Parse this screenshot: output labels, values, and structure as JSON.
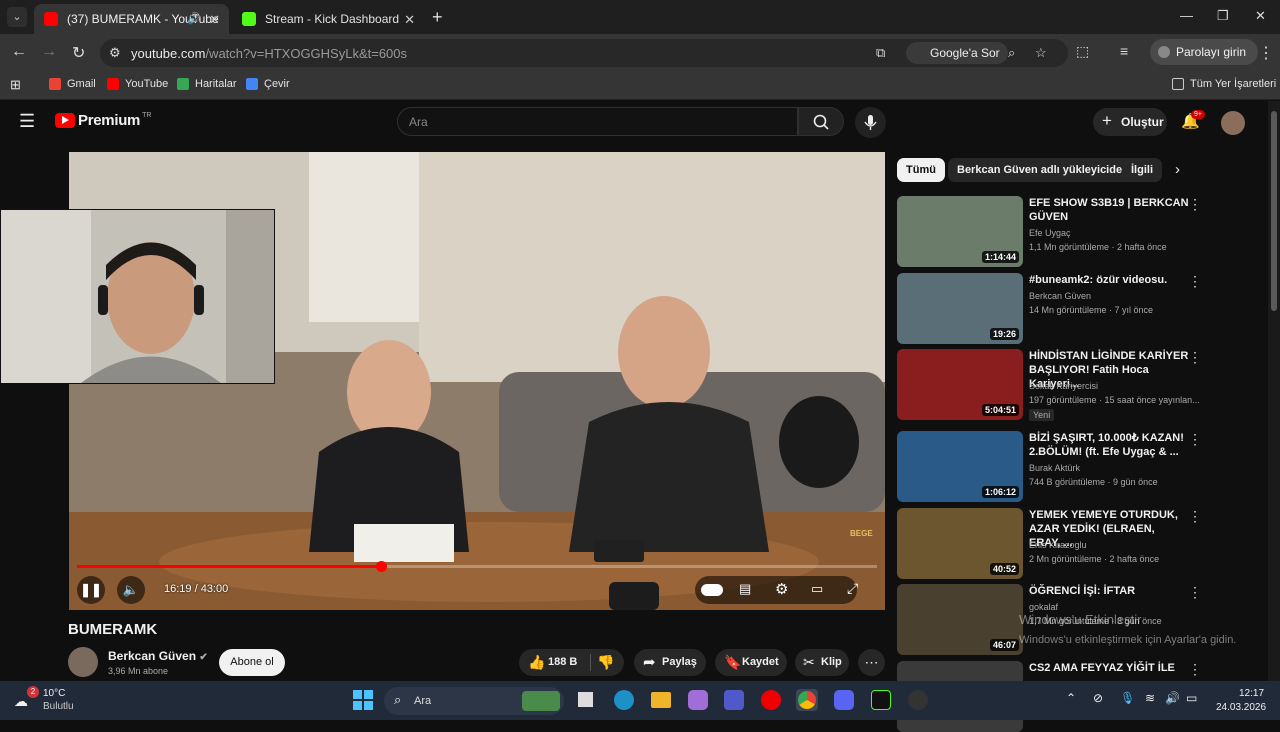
{
  "browser": {
    "tabs": [
      {
        "title": "(37) BUMERAMK - YouTube",
        "active": true
      },
      {
        "title": "Stream - Kick Dashboard",
        "active": false
      }
    ],
    "url_host": "youtube.com",
    "url_path": "/watch?v=HTXOGGHSyLk&t=600s",
    "google_ask": "Google'a Sor",
    "profile_button": "Parolayı girin",
    "bookmarks": [
      "Gmail",
      "YouTube",
      "Haritalar",
      "Çevir"
    ],
    "all_bookmarks": "Tüm Yer İşaretleri"
  },
  "youtube": {
    "logo": "Premium",
    "logo_region": "TR",
    "search_placeholder": "Ara",
    "create_label": "Oluştur",
    "notification_count": "9+"
  },
  "video": {
    "title": "BUMERAMK",
    "time": "16:19 / 43:00",
    "progress": 0.38,
    "channel": "Berkcan Güven",
    "subscribers": "3,96 Mn abone",
    "subscribe_label": "Abone ol",
    "likes": "188 B",
    "share_label": "Paylaş",
    "save_label": "Kaydet",
    "clip_label": "Klip",
    "watermark": "BEGE"
  },
  "chips": [
    "Tümü",
    "Berkcan Güven adlı yükleyiciden",
    "İlgili"
  ],
  "suggestions": [
    {
      "title": "EFE SHOW S3B19 | BERKCAN GÜVEN",
      "channel": "Efe Uygaç",
      "meta": "1,1 Mn görüntüleme · 2 hafta önce",
      "duration": "1:14:44",
      "thumb_color": "#6b7d6a"
    },
    {
      "title": "#buneamk2: özür videosu.",
      "channel": "Berkcan Güven",
      "meta": "14 Mn görüntüleme · 7 yıl önce",
      "duration": "19:26",
      "thumb_color": "#5a6e78"
    },
    {
      "title": "HİNDİSTAN LİGİNDE KARİYER BAŞLIYOR! Fatih Hoca Kariyeri...",
      "channel": "Sokak Kariyercisi",
      "meta": "197 görüntüleme · 15 saat önce yayınlan...",
      "duration": "5:04:51",
      "badge": "Yeni",
      "thumb_color": "#8a1d1d"
    },
    {
      "title": "BİZİ ŞAŞIRT, 10.000₺ KAZAN! 2.BÖLÜM! (ft. Efe Uygaç & ...",
      "channel": "Burak Aktürk",
      "meta": "744 B görüntüleme · 9 gün önce",
      "duration": "1:06:12",
      "thumb_color": "#2a5b88"
    },
    {
      "title": "YEMEK YEMEYE OTURDUK, AZAR YEDİK! (ELRAEN, ERAY, ...",
      "channel": "Enis Kirazoglu",
      "meta": "2 Mn görüntüleme · 2 hafta önce",
      "duration": "40:52",
      "thumb_color": "#6c5630"
    },
    {
      "title": "ÖĞRENCİ İŞİ: İFTAR",
      "channel": "gokalaf",
      "meta": "1,7 Mn görüntüleme · 3 gün önce",
      "duration": "46:07",
      "thumb_color": "#4a4030"
    },
    {
      "title": "CS2 AMA FEYYAZ YİĞİT İLE",
      "channel": "",
      "meta": "",
      "duration": "",
      "thumb_color": "#3a3a3a"
    }
  ],
  "windows_activation": {
    "line1": "Windows'u Etkinleştir",
    "line2": "Windows'u etkinleştirmek için Ayarlar'a gidin."
  },
  "taskbar": {
    "weather_temp": "10°C",
    "weather_desc": "Bulutlu",
    "weather_badge": "2",
    "search_label": "Ara",
    "time": "12:17",
    "date": "24.03.2026"
  }
}
